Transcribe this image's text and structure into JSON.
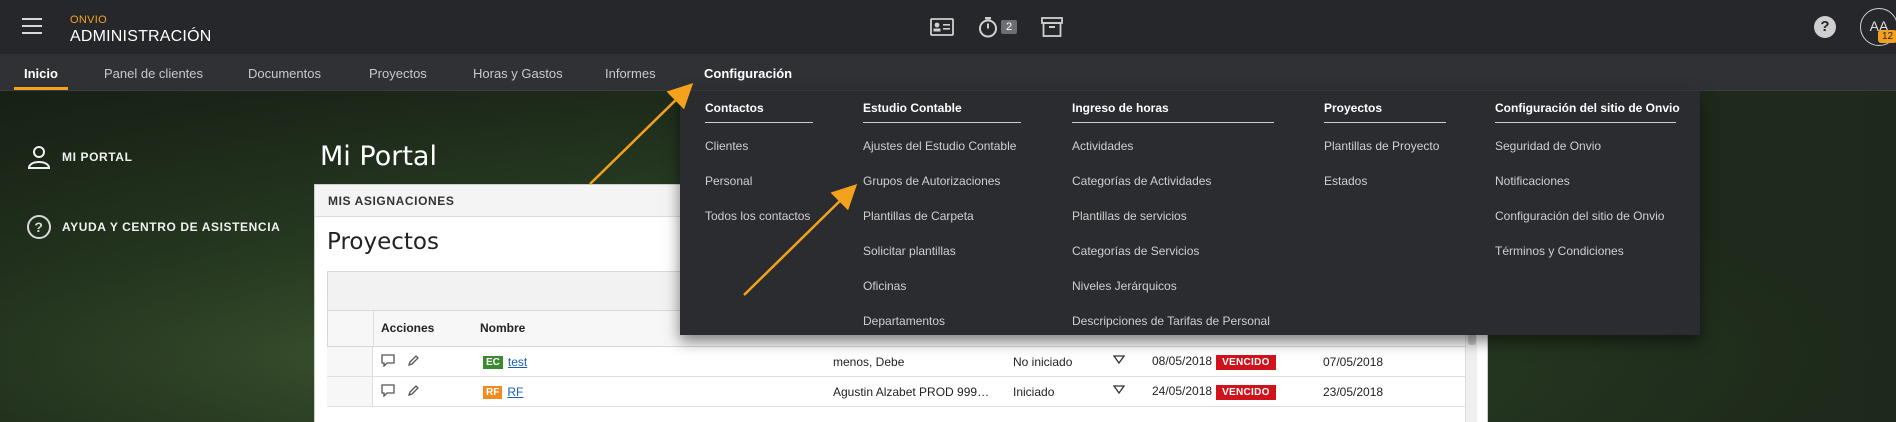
{
  "app": {
    "brand_sub": "ONVIO",
    "brand_main": "ADMINISTRACIÓN",
    "timer_count": "2",
    "avatar_initials": "AA",
    "avatar_badge": "12",
    "help_glyph": "?"
  },
  "nav": {
    "items": [
      "Inicio",
      "Panel de clientes",
      "Documentos",
      "Proyectos",
      "Horas y Gastos",
      "Informes",
      "Configuración"
    ],
    "active": "Inicio",
    "accent_color": "#f4a11d"
  },
  "sidebar": {
    "portal": "MI PORTAL",
    "help": "AYUDA Y CENTRO DE ASISTENCIA"
  },
  "page": {
    "title": "Mi Portal",
    "card_header": "MIS ASIGNACIONES",
    "card_title": "Proyectos"
  },
  "table": {
    "headers": [
      "Acciones",
      "Nombre"
    ],
    "rows": [
      {
        "tag": "EC",
        "name": "test",
        "client": "menos, Debe",
        "status": "No iniciado",
        "due": "08/05/2018",
        "flag": "VENCIDO",
        "date2": "07/05/2018"
      },
      {
        "tag": "RF",
        "name": "RF",
        "client": "Agustin Alzabet PROD 999…",
        "status": "Iniciado",
        "due": "24/05/2018",
        "flag": "VENCIDO",
        "date2": "23/05/2018"
      }
    ]
  },
  "menu": {
    "columns": [
      {
        "title": "Contactos",
        "items": [
          "Clientes",
          "Personal",
          "Todos los contactos"
        ]
      },
      {
        "title": "Estudio Contable",
        "items": [
          "Ajustes del Estudio Contable",
          "Grupos de Autorizaciones",
          "Plantillas de Carpeta",
          "Solicitar plantillas",
          "Oficinas",
          "Departamentos"
        ]
      },
      {
        "title": "Ingreso de horas",
        "items": [
          "Actividades",
          "Categorías de Actividades",
          "Plantillas de servicios",
          "Categorías de Servicios",
          "Niveles Jerárquicos",
          "Descripciones de Tarifas de Personal"
        ]
      },
      {
        "title": "Proyectos",
        "items": [
          "Plantillas de Proyecto",
          "Estados"
        ]
      },
      {
        "title": "Configuración del sitio de Onvio",
        "items": [
          "Seguridad de Onvio",
          "Notificaciones",
          "Configuración del sitio de Onvio",
          "Términos y Condiciones"
        ]
      }
    ]
  },
  "icons": [
    "menu-icon",
    "contact-card-icon",
    "stopwatch-icon",
    "archive-box-icon",
    "help-icon",
    "person-icon",
    "question-circle-icon",
    "comment-icon",
    "pencil-icon",
    "chevron-down-icon"
  ],
  "annotation_color": "#f4a11d"
}
